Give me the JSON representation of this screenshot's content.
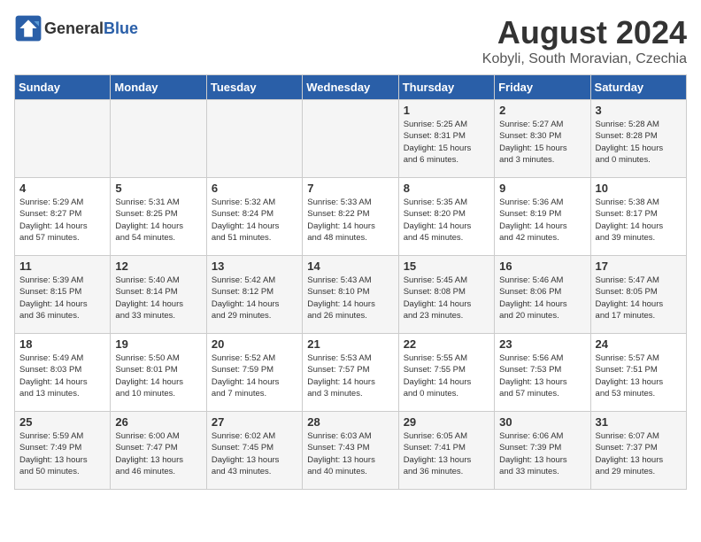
{
  "logo": {
    "general": "General",
    "blue": "Blue"
  },
  "title": "August 2024",
  "subtitle": "Kobyli, South Moravian, Czechia",
  "days_header": [
    "Sunday",
    "Monday",
    "Tuesday",
    "Wednesday",
    "Thursday",
    "Friday",
    "Saturday"
  ],
  "weeks": [
    [
      {
        "day": "",
        "detail": ""
      },
      {
        "day": "",
        "detail": ""
      },
      {
        "day": "",
        "detail": ""
      },
      {
        "day": "",
        "detail": ""
      },
      {
        "day": "1",
        "detail": "Sunrise: 5:25 AM\nSunset: 8:31 PM\nDaylight: 15 hours\nand 6 minutes."
      },
      {
        "day": "2",
        "detail": "Sunrise: 5:27 AM\nSunset: 8:30 PM\nDaylight: 15 hours\nand 3 minutes."
      },
      {
        "day": "3",
        "detail": "Sunrise: 5:28 AM\nSunset: 8:28 PM\nDaylight: 15 hours\nand 0 minutes."
      }
    ],
    [
      {
        "day": "4",
        "detail": "Sunrise: 5:29 AM\nSunset: 8:27 PM\nDaylight: 14 hours\nand 57 minutes."
      },
      {
        "day": "5",
        "detail": "Sunrise: 5:31 AM\nSunset: 8:25 PM\nDaylight: 14 hours\nand 54 minutes."
      },
      {
        "day": "6",
        "detail": "Sunrise: 5:32 AM\nSunset: 8:24 PM\nDaylight: 14 hours\nand 51 minutes."
      },
      {
        "day": "7",
        "detail": "Sunrise: 5:33 AM\nSunset: 8:22 PM\nDaylight: 14 hours\nand 48 minutes."
      },
      {
        "day": "8",
        "detail": "Sunrise: 5:35 AM\nSunset: 8:20 PM\nDaylight: 14 hours\nand 45 minutes."
      },
      {
        "day": "9",
        "detail": "Sunrise: 5:36 AM\nSunset: 8:19 PM\nDaylight: 14 hours\nand 42 minutes."
      },
      {
        "day": "10",
        "detail": "Sunrise: 5:38 AM\nSunset: 8:17 PM\nDaylight: 14 hours\nand 39 minutes."
      }
    ],
    [
      {
        "day": "11",
        "detail": "Sunrise: 5:39 AM\nSunset: 8:15 PM\nDaylight: 14 hours\nand 36 minutes."
      },
      {
        "day": "12",
        "detail": "Sunrise: 5:40 AM\nSunset: 8:14 PM\nDaylight: 14 hours\nand 33 minutes."
      },
      {
        "day": "13",
        "detail": "Sunrise: 5:42 AM\nSunset: 8:12 PM\nDaylight: 14 hours\nand 29 minutes."
      },
      {
        "day": "14",
        "detail": "Sunrise: 5:43 AM\nSunset: 8:10 PM\nDaylight: 14 hours\nand 26 minutes."
      },
      {
        "day": "15",
        "detail": "Sunrise: 5:45 AM\nSunset: 8:08 PM\nDaylight: 14 hours\nand 23 minutes."
      },
      {
        "day": "16",
        "detail": "Sunrise: 5:46 AM\nSunset: 8:06 PM\nDaylight: 14 hours\nand 20 minutes."
      },
      {
        "day": "17",
        "detail": "Sunrise: 5:47 AM\nSunset: 8:05 PM\nDaylight: 14 hours\nand 17 minutes."
      }
    ],
    [
      {
        "day": "18",
        "detail": "Sunrise: 5:49 AM\nSunset: 8:03 PM\nDaylight: 14 hours\nand 13 minutes."
      },
      {
        "day": "19",
        "detail": "Sunrise: 5:50 AM\nSunset: 8:01 PM\nDaylight: 14 hours\nand 10 minutes."
      },
      {
        "day": "20",
        "detail": "Sunrise: 5:52 AM\nSunset: 7:59 PM\nDaylight: 14 hours\nand 7 minutes."
      },
      {
        "day": "21",
        "detail": "Sunrise: 5:53 AM\nSunset: 7:57 PM\nDaylight: 14 hours\nand 3 minutes."
      },
      {
        "day": "22",
        "detail": "Sunrise: 5:55 AM\nSunset: 7:55 PM\nDaylight: 14 hours\nand 0 minutes."
      },
      {
        "day": "23",
        "detail": "Sunrise: 5:56 AM\nSunset: 7:53 PM\nDaylight: 13 hours\nand 57 minutes."
      },
      {
        "day": "24",
        "detail": "Sunrise: 5:57 AM\nSunset: 7:51 PM\nDaylight: 13 hours\nand 53 minutes."
      }
    ],
    [
      {
        "day": "25",
        "detail": "Sunrise: 5:59 AM\nSunset: 7:49 PM\nDaylight: 13 hours\nand 50 minutes."
      },
      {
        "day": "26",
        "detail": "Sunrise: 6:00 AM\nSunset: 7:47 PM\nDaylight: 13 hours\nand 46 minutes."
      },
      {
        "day": "27",
        "detail": "Sunrise: 6:02 AM\nSunset: 7:45 PM\nDaylight: 13 hours\nand 43 minutes."
      },
      {
        "day": "28",
        "detail": "Sunrise: 6:03 AM\nSunset: 7:43 PM\nDaylight: 13 hours\nand 40 minutes."
      },
      {
        "day": "29",
        "detail": "Sunrise: 6:05 AM\nSunset: 7:41 PM\nDaylight: 13 hours\nand 36 minutes."
      },
      {
        "day": "30",
        "detail": "Sunrise: 6:06 AM\nSunset: 7:39 PM\nDaylight: 13 hours\nand 33 minutes."
      },
      {
        "day": "31",
        "detail": "Sunrise: 6:07 AM\nSunset: 7:37 PM\nDaylight: 13 hours\nand 29 minutes."
      }
    ]
  ]
}
